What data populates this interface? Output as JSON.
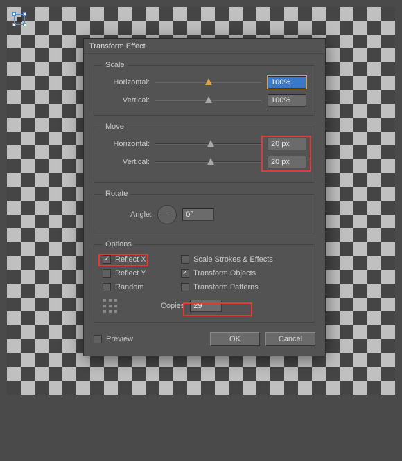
{
  "dialog": {
    "title": "Transform Effect"
  },
  "scale": {
    "legend": "Scale",
    "horizontal_label": "Horizontal:",
    "vertical_label": "Vertical:",
    "horizontal_value": "100%",
    "vertical_value": "100%"
  },
  "move": {
    "legend": "Move",
    "horizontal_label": "Horizontal:",
    "vertical_label": "Vertical:",
    "horizontal_value": "20 px",
    "vertical_value": "20 px"
  },
  "rotate": {
    "legend": "Rotate",
    "angle_label": "Angle:",
    "angle_value": "0°"
  },
  "options": {
    "legend": "Options",
    "reflect_x": {
      "label": "Reflect X",
      "checked": true
    },
    "scale_strokes": {
      "label": "Scale Strokes & Effects",
      "checked": false
    },
    "reflect_y": {
      "label": "Reflect Y",
      "checked": false
    },
    "transform_objects": {
      "label": "Transform Objects",
      "checked": true
    },
    "random": {
      "label": "Random",
      "checked": false
    },
    "transform_patterns": {
      "label": "Transform Patterns",
      "checked": false
    },
    "copies_label": "Copies",
    "copies_value": "29"
  },
  "bottom": {
    "preview": {
      "label": "Preview",
      "checked": false
    },
    "ok": "OK",
    "cancel": "Cancel"
  }
}
